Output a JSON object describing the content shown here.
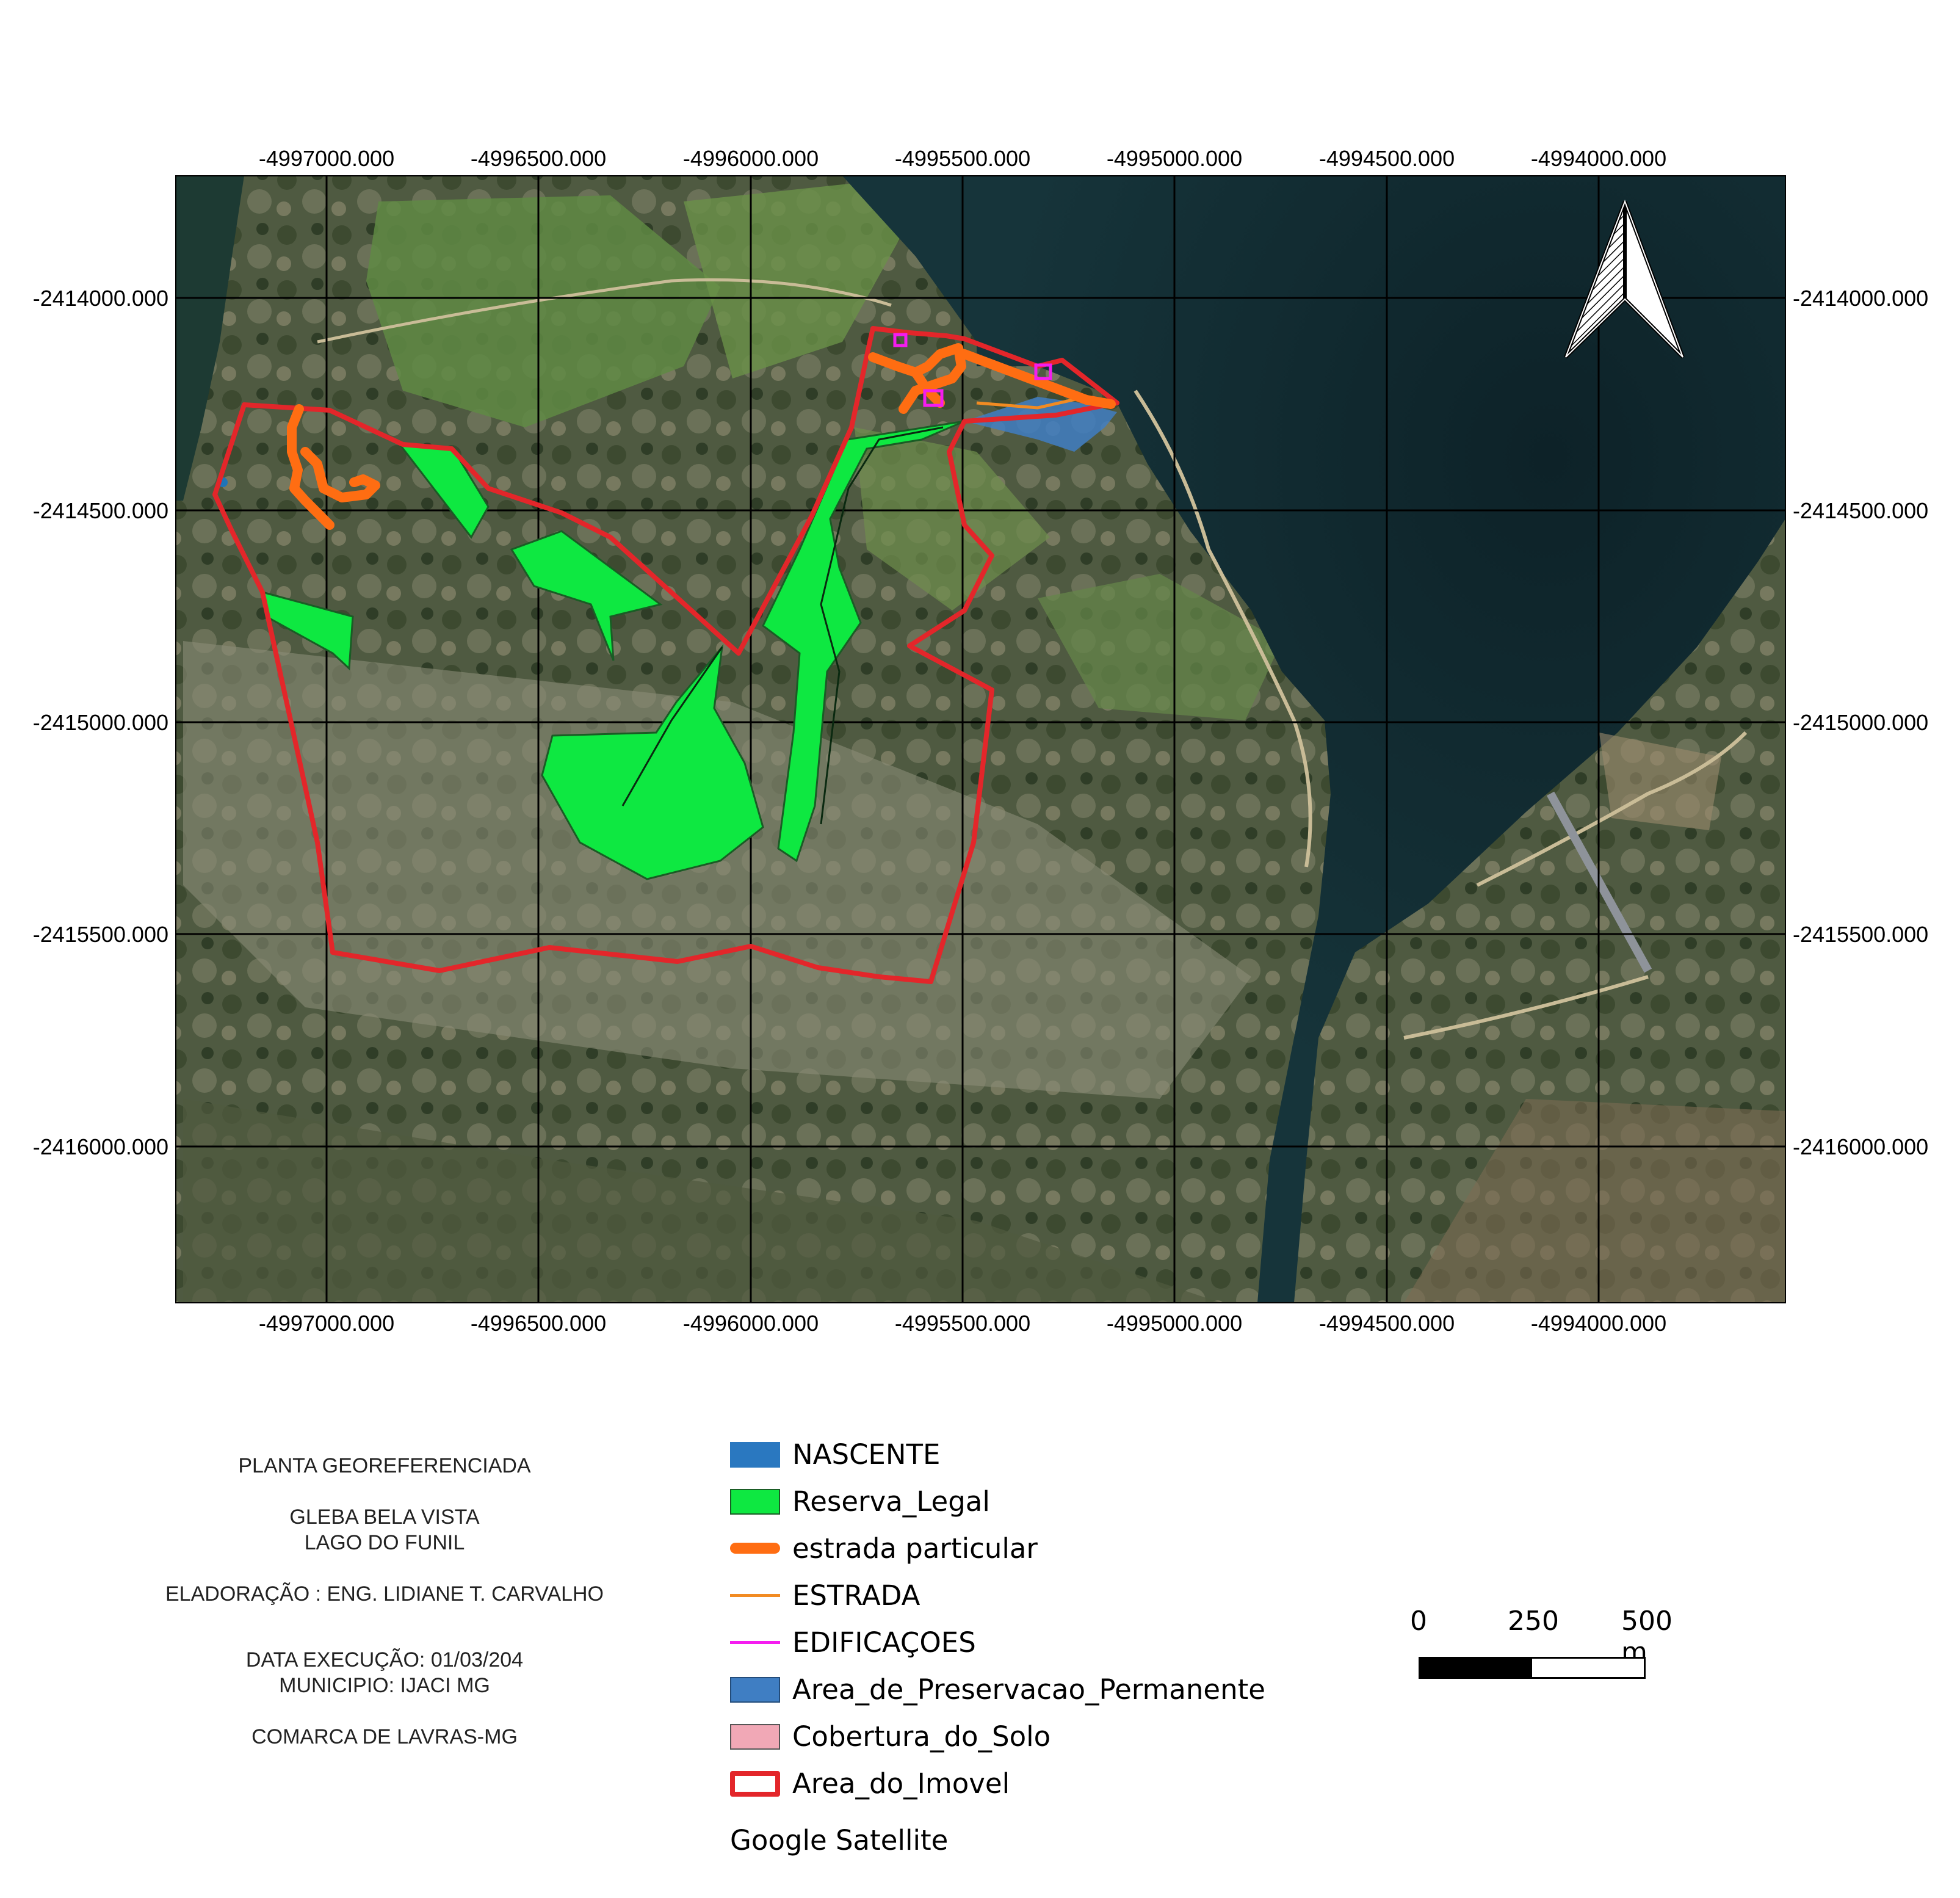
{
  "map": {
    "x_ticks_top": [
      "-4997000.000",
      "-4996500.000",
      "-4996000.000",
      "-4995500.000",
      "-4995000.000",
      "-4994500.000",
      "-4994000.000"
    ],
    "x_ticks_bottom": [
      "-4997000.000",
      "-4996500.000",
      "-4996000.000",
      "-4995500.000",
      "-4995000.000",
      "-4994500.000",
      "-4994000.000"
    ],
    "y_ticks_left": [
      "-2414000.000",
      "-2414500.000",
      "-2415000.000",
      "-2415500.000",
      "-2416000.000"
    ],
    "y_ticks_right": [
      "-2414000.000",
      "-2414500.000",
      "-2415000.000",
      "-2415500.000",
      "-2416000.000"
    ],
    "colors": {
      "property_boundary": "#e3262a",
      "legal_reserve": "#0ee841",
      "private_road": "#ff6d12",
      "road": "#f28b22",
      "buildings": "#f51cf0",
      "app_area": "#3f7ec3",
      "spring": "#1f74b8",
      "water": "#0f2a30"
    },
    "north_arrow_icon": "north-arrow-icon"
  },
  "legend": {
    "items": [
      {
        "label": "NASCENTE",
        "icon": "fill-swatch",
        "color": "#2a78c0"
      },
      {
        "label": "Reserva_Legal",
        "icon": "fill-swatch",
        "color": "#0ee841"
      },
      {
        "label": "estrada particular",
        "icon": "thick-line-swatch",
        "color": "#ff6d12"
      },
      {
        "label": "ESTRADA",
        "icon": "line-swatch",
        "color": "#f28b22"
      },
      {
        "label": "EDIFICAÇOES",
        "icon": "line-swatch",
        "color": "#f51cf0"
      },
      {
        "label": "Area_de_Preservacao_Permanente",
        "icon": "fill-swatch",
        "color": "#3f7ec3"
      },
      {
        "label": "Cobertura_do_Solo",
        "icon": "fill-swatch",
        "color": "#f1a8b6"
      },
      {
        "label": "Area_do_Imovel",
        "icon": "outline-swatch",
        "color": "#e3262a"
      }
    ],
    "basemap": "Google Satellite"
  },
  "info": {
    "title": "PLANTA GEOREFERENCIADA",
    "property": "GLEBA BELA VISTA",
    "location": "LAGO DO FUNIL",
    "author": "ELADORAÇÃO : ENG. LIDIANE T. CARVALHO",
    "date": "DATA EXECUÇÃO: 01/03/204",
    "municipality": "MUNICIPIO: IJACI MG",
    "district": "COMARCA DE LAVRAS-MG"
  },
  "scale": {
    "labels": [
      "0",
      "250",
      "500 m"
    ]
  }
}
